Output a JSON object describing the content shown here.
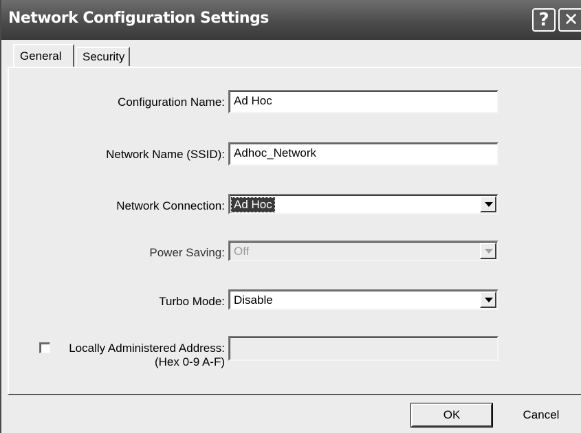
{
  "window": {
    "title": "Network Configuration Settings",
    "help_label": "?",
    "close_label": "✕"
  },
  "tabs": [
    {
      "label": "General"
    },
    {
      "label": "Security"
    }
  ],
  "form": {
    "config_name": {
      "label": "Configuration Name:",
      "value": "Ad Hoc"
    },
    "ssid": {
      "label": "Network Name (SSID):",
      "value": "Adhoc_Network"
    },
    "connection": {
      "label": "Network Connection:",
      "value": "Ad Hoc"
    },
    "power_saving": {
      "label": "Power Saving:",
      "value": "Off"
    },
    "turbo_mode": {
      "label": "Turbo Mode:",
      "value": "Disable"
    },
    "laa": {
      "label_line1": "Locally Administered Address:",
      "label_line2": "(Hex 0-9 A-F)",
      "value": ""
    }
  },
  "buttons": {
    "ok": "OK",
    "cancel": "Cancel"
  }
}
